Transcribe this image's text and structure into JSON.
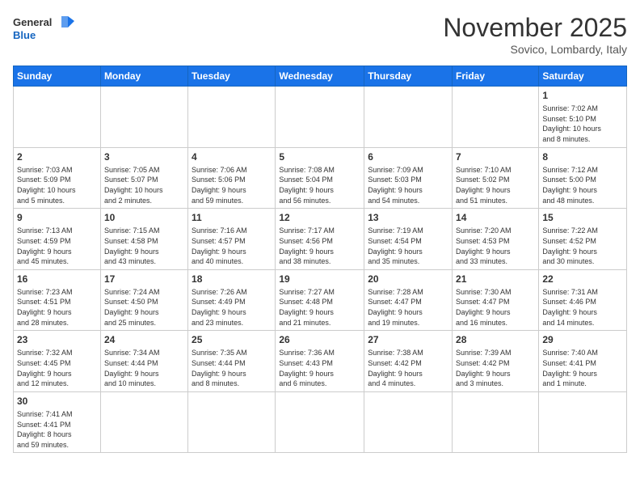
{
  "header": {
    "logo_general": "General",
    "logo_blue": "Blue",
    "month_title": "November 2025",
    "location": "Sovico, Lombardy, Italy"
  },
  "days_of_week": [
    "Sunday",
    "Monday",
    "Tuesday",
    "Wednesday",
    "Thursday",
    "Friday",
    "Saturday"
  ],
  "weeks": [
    [
      {
        "day": "",
        "info": ""
      },
      {
        "day": "",
        "info": ""
      },
      {
        "day": "",
        "info": ""
      },
      {
        "day": "",
        "info": ""
      },
      {
        "day": "",
        "info": ""
      },
      {
        "day": "",
        "info": ""
      },
      {
        "day": "1",
        "info": "Sunrise: 7:02 AM\nSunset: 5:10 PM\nDaylight: 10 hours\nand 8 minutes."
      }
    ],
    [
      {
        "day": "2",
        "info": "Sunrise: 7:03 AM\nSunset: 5:09 PM\nDaylight: 10 hours\nand 5 minutes."
      },
      {
        "day": "3",
        "info": "Sunrise: 7:05 AM\nSunset: 5:07 PM\nDaylight: 10 hours\nand 2 minutes."
      },
      {
        "day": "4",
        "info": "Sunrise: 7:06 AM\nSunset: 5:06 PM\nDaylight: 9 hours\nand 59 minutes."
      },
      {
        "day": "5",
        "info": "Sunrise: 7:08 AM\nSunset: 5:04 PM\nDaylight: 9 hours\nand 56 minutes."
      },
      {
        "day": "6",
        "info": "Sunrise: 7:09 AM\nSunset: 5:03 PM\nDaylight: 9 hours\nand 54 minutes."
      },
      {
        "day": "7",
        "info": "Sunrise: 7:10 AM\nSunset: 5:02 PM\nDaylight: 9 hours\nand 51 minutes."
      },
      {
        "day": "8",
        "info": "Sunrise: 7:12 AM\nSunset: 5:00 PM\nDaylight: 9 hours\nand 48 minutes."
      }
    ],
    [
      {
        "day": "9",
        "info": "Sunrise: 7:13 AM\nSunset: 4:59 PM\nDaylight: 9 hours\nand 45 minutes."
      },
      {
        "day": "10",
        "info": "Sunrise: 7:15 AM\nSunset: 4:58 PM\nDaylight: 9 hours\nand 43 minutes."
      },
      {
        "day": "11",
        "info": "Sunrise: 7:16 AM\nSunset: 4:57 PM\nDaylight: 9 hours\nand 40 minutes."
      },
      {
        "day": "12",
        "info": "Sunrise: 7:17 AM\nSunset: 4:56 PM\nDaylight: 9 hours\nand 38 minutes."
      },
      {
        "day": "13",
        "info": "Sunrise: 7:19 AM\nSunset: 4:54 PM\nDaylight: 9 hours\nand 35 minutes."
      },
      {
        "day": "14",
        "info": "Sunrise: 7:20 AM\nSunset: 4:53 PM\nDaylight: 9 hours\nand 33 minutes."
      },
      {
        "day": "15",
        "info": "Sunrise: 7:22 AM\nSunset: 4:52 PM\nDaylight: 9 hours\nand 30 minutes."
      }
    ],
    [
      {
        "day": "16",
        "info": "Sunrise: 7:23 AM\nSunset: 4:51 PM\nDaylight: 9 hours\nand 28 minutes."
      },
      {
        "day": "17",
        "info": "Sunrise: 7:24 AM\nSunset: 4:50 PM\nDaylight: 9 hours\nand 25 minutes."
      },
      {
        "day": "18",
        "info": "Sunrise: 7:26 AM\nSunset: 4:49 PM\nDaylight: 9 hours\nand 23 minutes."
      },
      {
        "day": "19",
        "info": "Sunrise: 7:27 AM\nSunset: 4:48 PM\nDaylight: 9 hours\nand 21 minutes."
      },
      {
        "day": "20",
        "info": "Sunrise: 7:28 AM\nSunset: 4:47 PM\nDaylight: 9 hours\nand 19 minutes."
      },
      {
        "day": "21",
        "info": "Sunrise: 7:30 AM\nSunset: 4:47 PM\nDaylight: 9 hours\nand 16 minutes."
      },
      {
        "day": "22",
        "info": "Sunrise: 7:31 AM\nSunset: 4:46 PM\nDaylight: 9 hours\nand 14 minutes."
      }
    ],
    [
      {
        "day": "23",
        "info": "Sunrise: 7:32 AM\nSunset: 4:45 PM\nDaylight: 9 hours\nand 12 minutes."
      },
      {
        "day": "24",
        "info": "Sunrise: 7:34 AM\nSunset: 4:44 PM\nDaylight: 9 hours\nand 10 minutes."
      },
      {
        "day": "25",
        "info": "Sunrise: 7:35 AM\nSunset: 4:44 PM\nDaylight: 9 hours\nand 8 minutes."
      },
      {
        "day": "26",
        "info": "Sunrise: 7:36 AM\nSunset: 4:43 PM\nDaylight: 9 hours\nand 6 minutes."
      },
      {
        "day": "27",
        "info": "Sunrise: 7:38 AM\nSunset: 4:42 PM\nDaylight: 9 hours\nand 4 minutes."
      },
      {
        "day": "28",
        "info": "Sunrise: 7:39 AM\nSunset: 4:42 PM\nDaylight: 9 hours\nand 3 minutes."
      },
      {
        "day": "29",
        "info": "Sunrise: 7:40 AM\nSunset: 4:41 PM\nDaylight: 9 hours\nand 1 minute."
      }
    ],
    [
      {
        "day": "30",
        "info": "Sunrise: 7:41 AM\nSunset: 4:41 PM\nDaylight: 8 hours\nand 59 minutes."
      },
      {
        "day": "",
        "info": ""
      },
      {
        "day": "",
        "info": ""
      },
      {
        "day": "",
        "info": ""
      },
      {
        "day": "",
        "info": ""
      },
      {
        "day": "",
        "info": ""
      },
      {
        "day": "",
        "info": ""
      }
    ]
  ]
}
